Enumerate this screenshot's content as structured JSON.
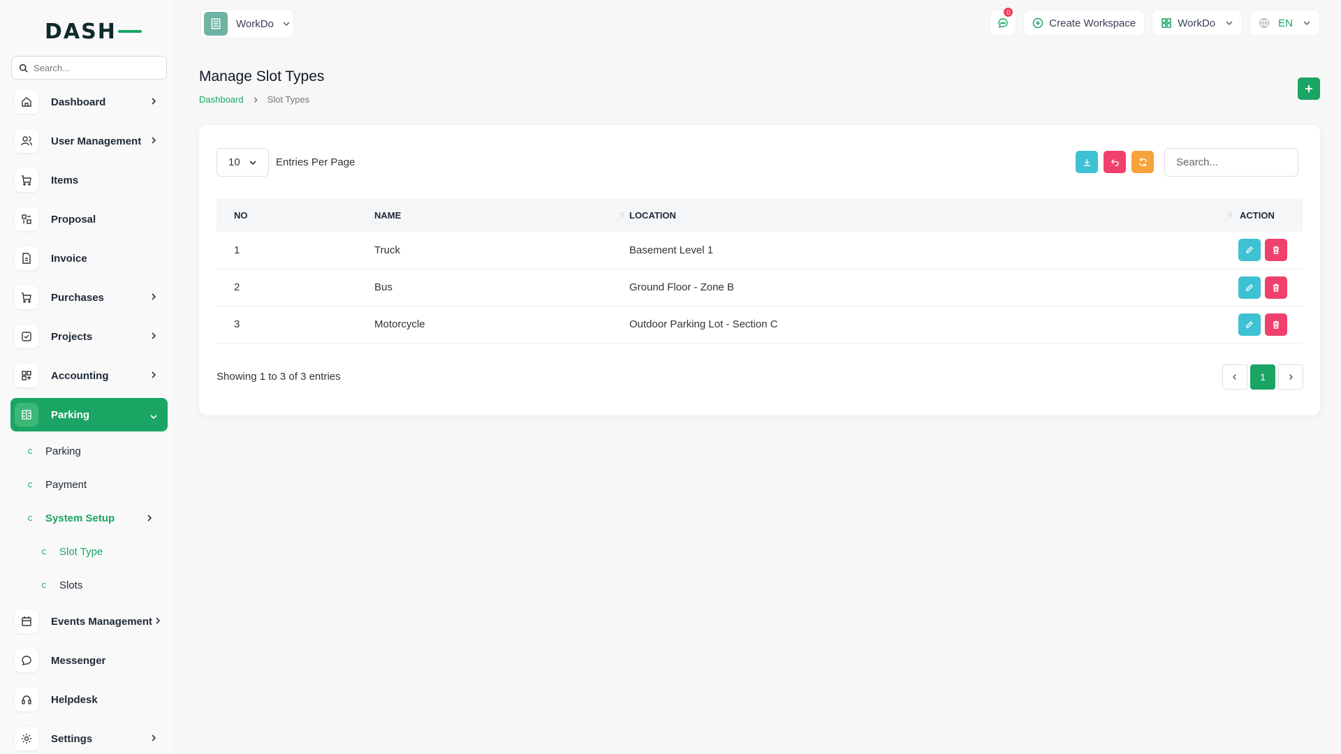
{
  "brand": {
    "logo_text": "DASH"
  },
  "sidebar": {
    "search_placeholder": "Search...",
    "items": [
      {
        "label": "Dashboard",
        "icon": "home-icon",
        "has_chevron": true
      },
      {
        "label": "User Management",
        "icon": "users-icon",
        "has_chevron": true
      },
      {
        "label": "Items",
        "icon": "cart-icon",
        "has_chevron": false
      },
      {
        "label": "Proposal",
        "icon": "proposal-icon",
        "has_chevron": false
      },
      {
        "label": "Invoice",
        "icon": "file-icon",
        "has_chevron": false
      },
      {
        "label": "Purchases",
        "icon": "cart-icon",
        "has_chevron": true
      },
      {
        "label": "Projects",
        "icon": "check-square-icon",
        "has_chevron": true
      },
      {
        "label": "Accounting",
        "icon": "grid-icon",
        "has_chevron": true
      },
      {
        "label": "Parking",
        "icon": "parking-icon",
        "has_chevron": true,
        "active": true
      }
    ],
    "parking_sub": [
      {
        "label": "Parking"
      },
      {
        "label": "Payment"
      },
      {
        "label": "System Setup",
        "has_chevron": true
      }
    ],
    "system_setup_sub": [
      {
        "label": "Slot Type"
      },
      {
        "label": "Slots"
      }
    ],
    "bottom_items": [
      {
        "label": "Events Management",
        "icon": "calendar-icon",
        "has_chevron": true
      },
      {
        "label": "Messenger",
        "icon": "message-icon",
        "has_chevron": false
      },
      {
        "label": "Helpdesk",
        "icon": "headset-icon",
        "has_chevron": false
      },
      {
        "label": "Settings",
        "icon": "gear-icon",
        "has_chevron": true
      }
    ]
  },
  "topbar": {
    "workspace_name": "WorkDo",
    "notification_count": "0",
    "create_workspace": "Create Workspace",
    "company": "WorkDo",
    "language": "EN"
  },
  "page": {
    "title": "Manage Slot Types",
    "breadcrumb": {
      "home": "Dashboard",
      "current": "Slot Types"
    }
  },
  "table": {
    "per_page": "10",
    "per_page_label": "Entries Per Page",
    "search_placeholder": "Search...",
    "headers": {
      "no": "NO",
      "name": "NAME",
      "location": "LOCATION",
      "action": "ACTION"
    },
    "rows": [
      {
        "no": "1",
        "name": "Truck",
        "location": "Basement Level 1"
      },
      {
        "no": "2",
        "name": "Bus",
        "location": "Ground Floor - Zone B"
      },
      {
        "no": "3",
        "name": "Motorcycle",
        "location": "Outdoor Parking Lot - Section C"
      }
    ],
    "showing": "Showing 1 to 3 of 3 entries",
    "current_page": "1"
  },
  "colors": {
    "accent": "#1aa564",
    "info": "#3ec1d3",
    "danger": "#f0416c",
    "warning": "#f7a23b"
  }
}
